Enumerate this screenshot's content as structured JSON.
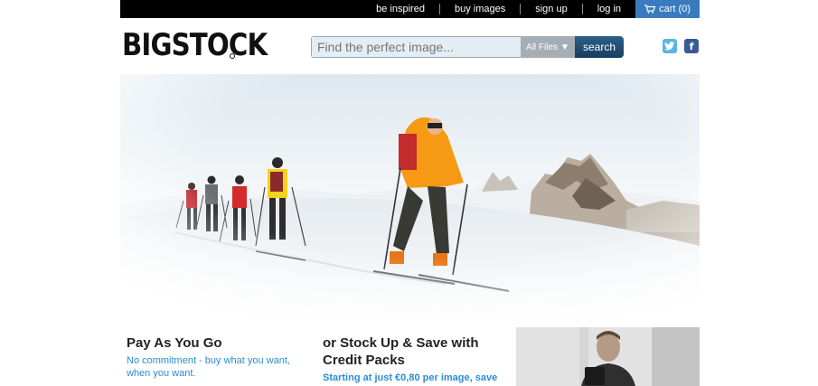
{
  "top_nav": {
    "items": [
      "be inspired",
      "buy images",
      "sign up",
      "log in"
    ],
    "cart_label": "cart (0)"
  },
  "header": {
    "logo_text": "BIGSTOCK",
    "search": {
      "placeholder": "Find the perfect image...",
      "filter_label": "All Files",
      "button_label": "search"
    },
    "social": [
      "twitter-icon",
      "facebook-icon"
    ]
  },
  "hero": {
    "scene": "ski-touring group in snowy mountains"
  },
  "promos": {
    "pay_as_you_go": {
      "title": "Pay As You Go",
      "line1": "No commitment - buy what you want,",
      "line2": "when you want."
    },
    "credit_packs": {
      "title_line1": "or Stock Up & Save with",
      "title_line2": "Credit Packs",
      "subtitle": "Starting at just €0,80 per image, save"
    }
  },
  "colors": {
    "top_bar": "#000000",
    "cart_bg": "#3a7bbf",
    "link_blue": "#2a8dd4",
    "search_button": "#1e4a70"
  }
}
